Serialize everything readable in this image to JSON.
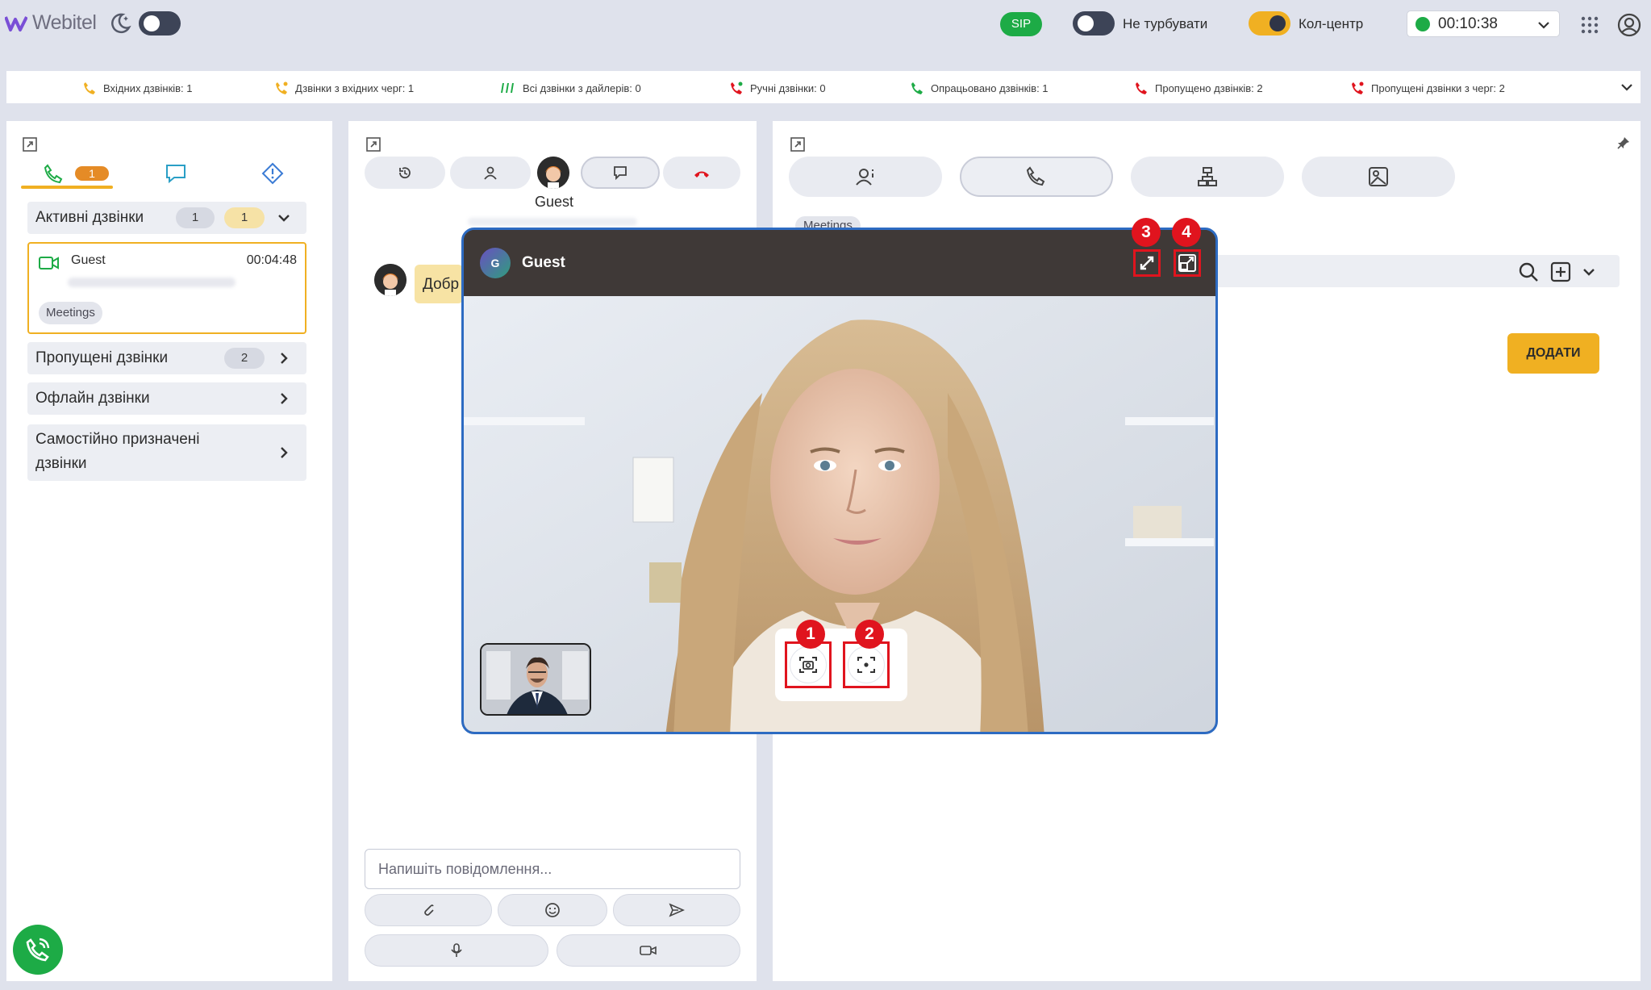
{
  "app": {
    "logo": "Webitel"
  },
  "topbar": {
    "sip_label": "SIP",
    "dnd_label": "Не турбувати",
    "callcenter_label": "Кол-центр",
    "timer": "00:10:38"
  },
  "stats": [
    {
      "label": "Вхідних дзвінків: 1",
      "icon": "incoming-call-icon",
      "color": "#f0b022"
    },
    {
      "label": "Дзвінки з вхідних черг: 1",
      "icon": "queue-call-icon",
      "color": "#f0b022"
    },
    {
      "label": "Всі дзвінки з дайлерів: 0",
      "icon": "dialer-icon",
      "color": "#1dab46"
    },
    {
      "label": "Ручні дзвінки: 0",
      "icon": "manual-call-icon",
      "color": "#e0141e"
    },
    {
      "label": "Опрацьовано дзвінків: 1",
      "icon": "processed-call-icon",
      "color": "#1dab46"
    },
    {
      "label": "Пропущено дзвінків: 2",
      "icon": "missed-call-icon",
      "color": "#e0141e"
    },
    {
      "label": "Пропущені дзвінки з черг: 2",
      "icon": "missed-queue-icon",
      "color": "#e0141e"
    }
  ],
  "left": {
    "tab_calls_badge": "1",
    "active": {
      "title": "Активні дзвінки",
      "count_grey": "1",
      "count_yellow": "1"
    },
    "call_card": {
      "name": "Guest",
      "time": "00:04:48",
      "tag": "Meetings"
    },
    "missed": {
      "title": "Пропущені дзвінки",
      "count": "2"
    },
    "offline": {
      "title": "Офлайн дзвінки"
    },
    "self_assigned": {
      "title_line1": "Самостійно призначені",
      "title_line2": "дзвінки"
    }
  },
  "middle": {
    "guest_label": "Guest",
    "chat_bubble": "Добр",
    "input_placeholder": "Напишіть повідомлення..."
  },
  "right": {
    "tag": "Meetings",
    "add_button": "ДОДАТИ"
  },
  "video": {
    "avatar_letter": "G",
    "name": "Guest",
    "markers": [
      "1",
      "2",
      "3",
      "4"
    ]
  },
  "colors": {
    "accent": "#f0b022",
    "green": "#1dab46",
    "red": "#e0141e",
    "border_blue": "#2d6bc2"
  }
}
